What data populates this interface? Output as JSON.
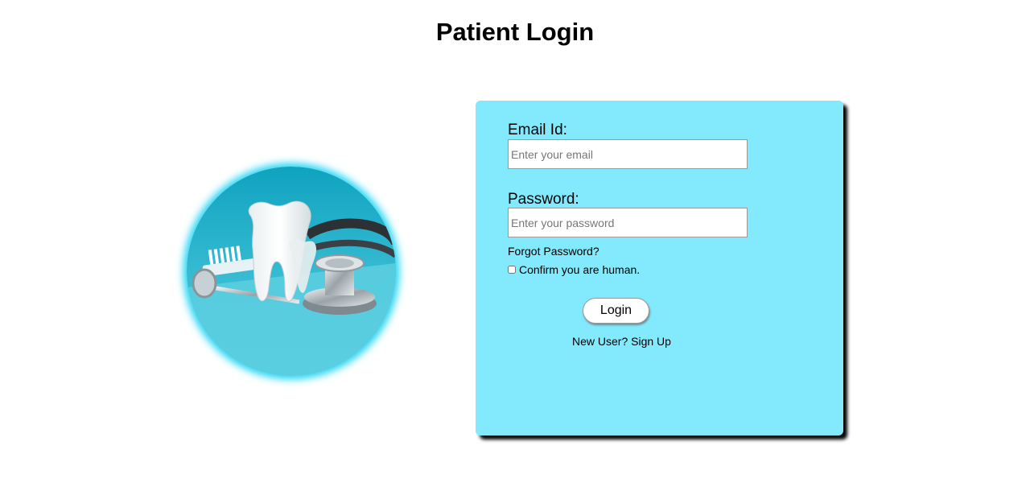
{
  "page": {
    "title": "Patient Login"
  },
  "hero": {
    "image_description": "dental-tooth-and-tools-image"
  },
  "form": {
    "email_label": "Email Id:",
    "email_placeholder": "Enter your email",
    "email_value": "",
    "password_label": "Password:",
    "password_placeholder": "Enter your password",
    "password_value": "",
    "forgot_password": "Forgot Password?",
    "captcha_label": "Confirm you are human.",
    "captcha_checked": false,
    "login_button": "Login",
    "signup_link": "New User? Sign Up"
  },
  "colors": {
    "card_background": "#83e9fc",
    "hero_glow": "#1ad4f5",
    "page_background": "#ffffff"
  }
}
